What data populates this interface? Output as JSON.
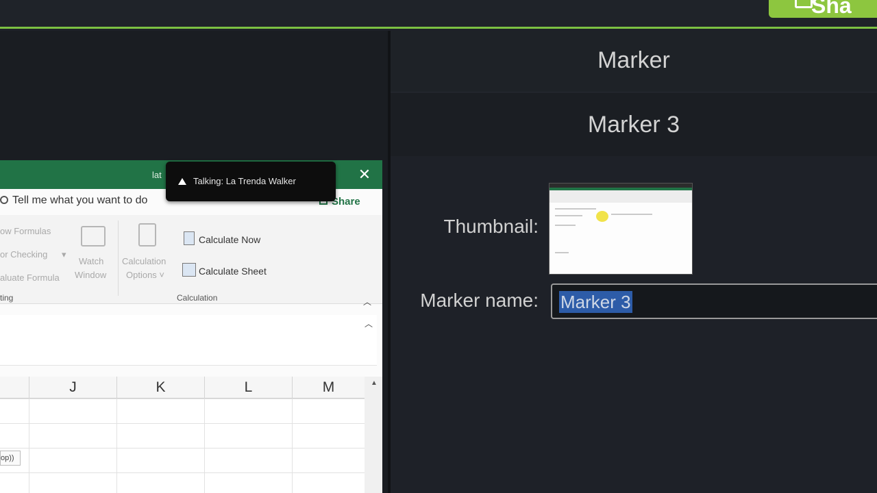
{
  "topbar": {
    "share_label": "Sha",
    "accent_color": "#8dc63f"
  },
  "excel": {
    "title_partial": "lat",
    "tell_me": "Tell me what you want to do",
    "share_label": "Share",
    "ribbon": {
      "show_formulas": "ow Formulas",
      "error_checking": "or Checking",
      "evaluate_formula": "aluate Formula",
      "group_auditing": "ting",
      "watch_window_line1": "Watch",
      "watch_window_line2": "Window",
      "calc_options_line1": "Calculation",
      "calc_options_line2": "Options ˅",
      "calculate_now": "Calculate Now",
      "calculate_sheet": "Calculate Sheet",
      "group_calculation": "Calculation"
    },
    "columns": [
      "J",
      "K",
      "L",
      "M"
    ],
    "cell_partial": "op))"
  },
  "toast": {
    "text": "Talking: La Trenda Walker"
  },
  "panel": {
    "title": "Marker",
    "marker_heading": "Marker 3",
    "thumbnail_label": "Thumbnail:",
    "name_label": "Marker name:",
    "name_value": "Marker 3"
  }
}
